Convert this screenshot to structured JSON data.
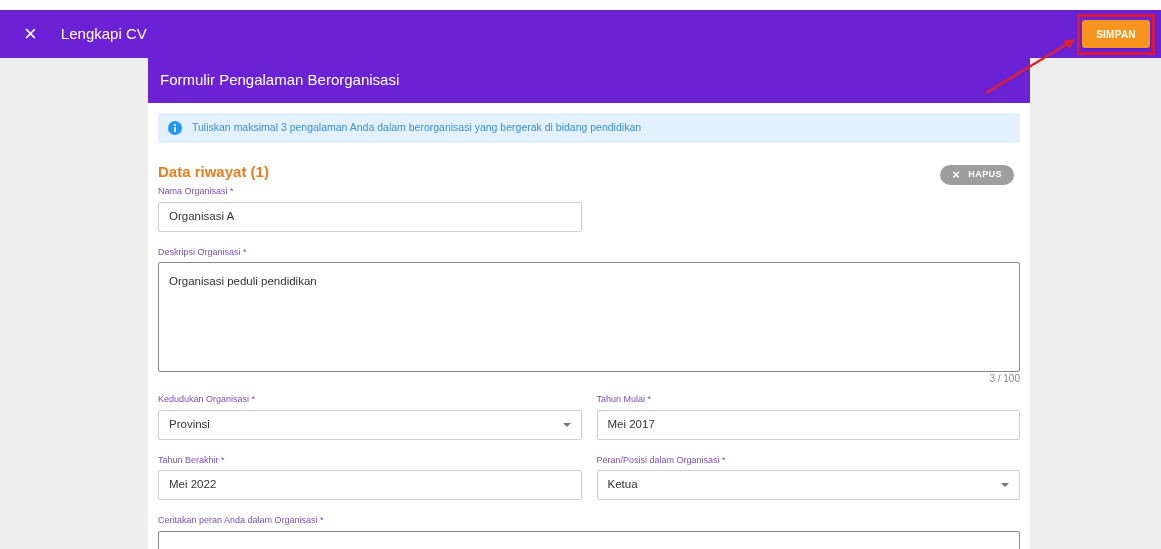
{
  "app_bar": {
    "close_icon": "×",
    "title": "Lengkapi CV",
    "save_button": "SIMPAN"
  },
  "form": {
    "title": "Formulir Pengalaman Berorganisasi",
    "info": "Tuliskan maksimal 3 pengalaman Anda dalam berorganisasi yang bergerak di bidang pendidikan",
    "entry_title": "Data riwayat (1)",
    "delete_button": {
      "icon": "×",
      "label": "HAPUS"
    },
    "fields": [
      {
        "kind": "text",
        "label": "Nama Organisasi *",
        "value": "Organisasi A"
      },
      {
        "kind": "textarea",
        "label": "Deskripsi Organisasi *",
        "value": "Organisasi peduli pendidikan",
        "counter": "3 / 100"
      },
      {
        "kind": "select",
        "label": "Kedudukan Organisasi *",
        "value": "Provinsi"
      },
      {
        "kind": "text",
        "label": "Tahun Mulai *",
        "value": "Mei 2017"
      },
      {
        "kind": "text",
        "label": "Tahun Berakhir *",
        "value": "Mei 2022"
      },
      {
        "kind": "select",
        "label": "Peran/Posisi dalam Organisasi *",
        "value": "Ketua"
      },
      {
        "kind": "textarea",
        "label": "Ceritakan peran Anda dalam Organisasi *"
      }
    ]
  }
}
